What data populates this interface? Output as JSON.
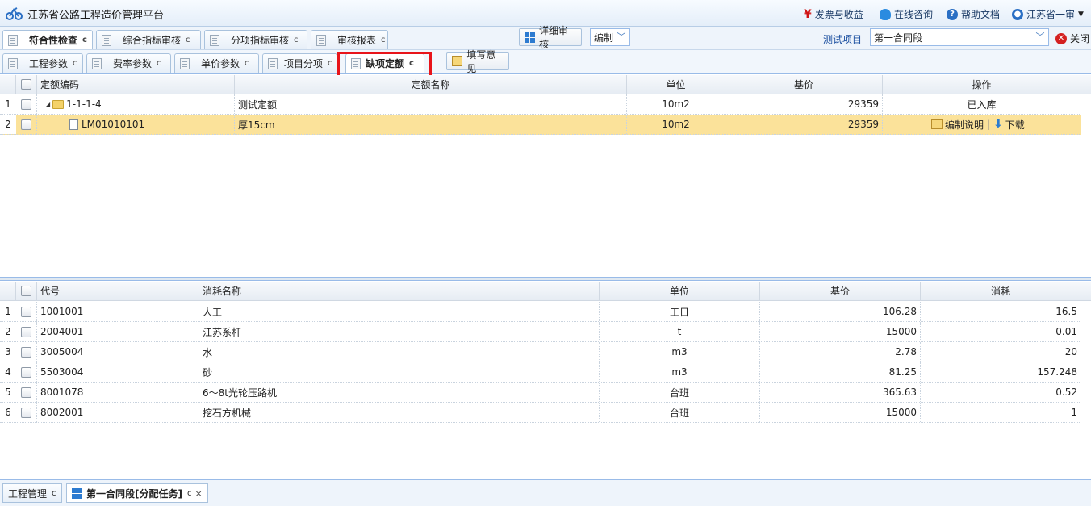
{
  "header": {
    "title": "江苏省公路工程造价管理平台",
    "links": {
      "invoice": "发票与收益",
      "consult": "在线咨询",
      "help": "帮助文档",
      "user": "江苏省一审"
    }
  },
  "top_tabs": [
    {
      "label": "符合性检查",
      "active": true
    },
    {
      "label": "综合指标审核",
      "active": false
    },
    {
      "label": "分项指标审核",
      "active": false
    },
    {
      "label": "审核报表",
      "active": false
    }
  ],
  "toolbar": {
    "detail_review": "详细审核",
    "mode_select": "编制",
    "project_label": "测试项目",
    "contract_select": "第一合同段",
    "close": "关闭"
  },
  "sub_tabs": [
    {
      "label": "工程参数"
    },
    {
      "label": "费率参数"
    },
    {
      "label": "单价参数"
    },
    {
      "label": "项目分项"
    },
    {
      "label": "缺项定额"
    }
  ],
  "fill_opinion": "填写意见",
  "quota_grid": {
    "columns": [
      "定额编码",
      "定额名称",
      "单位",
      "基价",
      "操作"
    ],
    "rows": [
      {
        "num": "1",
        "code": "1-1-1-4",
        "name": "测试定额",
        "unit": "10m2",
        "price": "29359",
        "op": "已入库"
      },
      {
        "num": "2",
        "code": "LM01010101",
        "name": "厚15cm",
        "unit": "10m2",
        "price": "29359",
        "op_edit": "编制说明",
        "op_download": "下载"
      }
    ]
  },
  "consume_grid": {
    "columns": [
      "代号",
      "消耗名称",
      "单位",
      "基价",
      "消耗"
    ],
    "rows": [
      {
        "num": "1",
        "code": "1001001",
        "name": "人工",
        "unit": "工日",
        "price": "106.28",
        "qty": "16.5"
      },
      {
        "num": "2",
        "code": "2004001",
        "name": "江苏系杆",
        "unit": "t",
        "price": "15000",
        "qty": "0.01"
      },
      {
        "num": "3",
        "code": "3005004",
        "name": "水",
        "unit": "m3",
        "price": "2.78",
        "qty": "20"
      },
      {
        "num": "4",
        "code": "5503004",
        "name": "砂",
        "unit": "m3",
        "price": "81.25",
        "qty": "157.248"
      },
      {
        "num": "5",
        "code": "8001078",
        "name": "6～8t光轮压路机",
        "unit": "台班",
        "price": "365.63",
        "qty": "0.52"
      },
      {
        "num": "6",
        "code": "8002001",
        "name": "挖石方机械",
        "unit": "台班",
        "price": "15000",
        "qty": "1"
      }
    ]
  },
  "bottom_tabs": [
    {
      "label": "工程管理"
    },
    {
      "label": "第一合同段[分配任务]"
    }
  ]
}
